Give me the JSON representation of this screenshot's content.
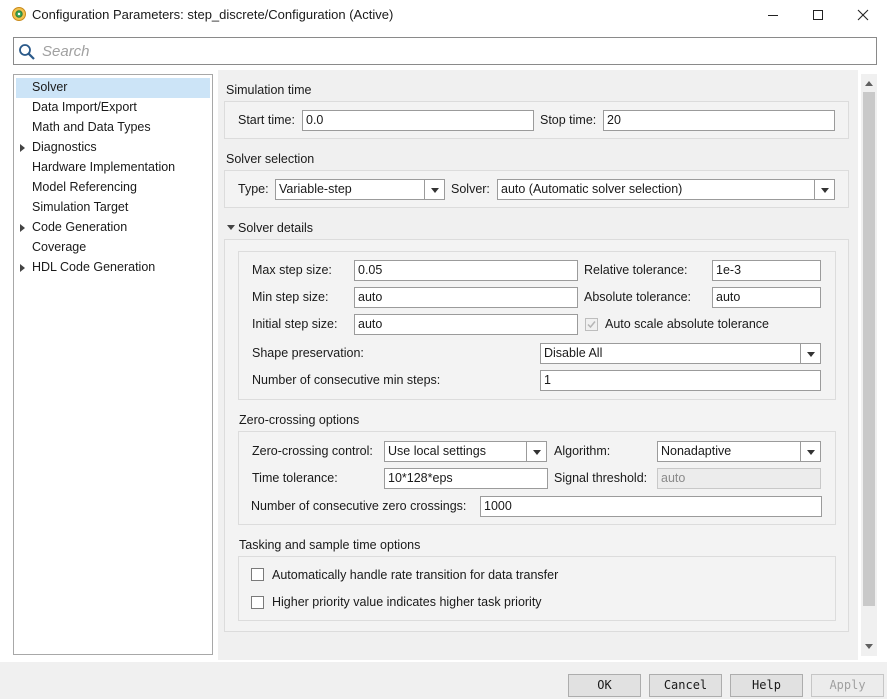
{
  "window": {
    "title": "Configuration Parameters: step_discrete/Configuration (Active)",
    "app_icon": "simulink-gear-icon"
  },
  "search": {
    "placeholder": "Search"
  },
  "tree": {
    "items": [
      {
        "label": "Solver",
        "selected": true,
        "expandable": false
      },
      {
        "label": "Data Import/Export",
        "selected": false,
        "expandable": false
      },
      {
        "label": "Math and Data Types",
        "selected": false,
        "expandable": false
      },
      {
        "label": "Diagnostics",
        "selected": false,
        "expandable": true
      },
      {
        "label": "Hardware Implementation",
        "selected": false,
        "expandable": false
      },
      {
        "label": "Model Referencing",
        "selected": false,
        "expandable": false
      },
      {
        "label": "Simulation Target",
        "selected": false,
        "expandable": false
      },
      {
        "label": "Code Generation",
        "selected": false,
        "expandable": true
      },
      {
        "label": "Coverage",
        "selected": false,
        "expandable": false
      },
      {
        "label": "HDL Code Generation",
        "selected": false,
        "expandable": true
      }
    ]
  },
  "simulation_time": {
    "title": "Simulation time",
    "start_label": "Start time:",
    "start_value": "0.0",
    "stop_label": "Stop time:",
    "stop_value": "20"
  },
  "solver_selection": {
    "title": "Solver selection",
    "type_label": "Type:",
    "type_value": "Variable-step",
    "solver_label": "Solver:",
    "solver_value": "auto (Automatic solver selection)"
  },
  "solver_details": {
    "title": "Solver details",
    "max_step_label": "Max step size:",
    "max_step_value": "0.05",
    "rel_tol_label": "Relative tolerance:",
    "rel_tol_value": "1e-3",
    "min_step_label": "Min step size:",
    "min_step_value": "auto",
    "abs_tol_label": "Absolute tolerance:",
    "abs_tol_value": "auto",
    "init_step_label": "Initial step size:",
    "init_step_value": "auto",
    "auto_scale_label": "Auto scale absolute tolerance",
    "shape_label": "Shape preservation:",
    "shape_value": "Disable All",
    "consec_min_label": "Number of consecutive min steps:",
    "consec_min_value": "1"
  },
  "zero_crossing": {
    "title": "Zero-crossing options",
    "control_label": "Zero-crossing control:",
    "control_value": "Use local settings",
    "algorithm_label": "Algorithm:",
    "algorithm_value": "Nonadaptive",
    "time_tol_label": "Time tolerance:",
    "time_tol_value": "10*128*eps",
    "signal_threshold_label": "Signal threshold:",
    "signal_threshold_value": "auto",
    "consec_zc_label": "Number of consecutive zero crossings:",
    "consec_zc_value": "1000"
  },
  "tasking": {
    "title": "Tasking and sample time options",
    "auto_rate_label": "Automatically handle rate transition for data transfer",
    "priority_label": "Higher priority value indicates higher task priority"
  },
  "buttons": {
    "ok": "OK",
    "cancel": "Cancel",
    "help": "Help",
    "apply": "Apply"
  }
}
